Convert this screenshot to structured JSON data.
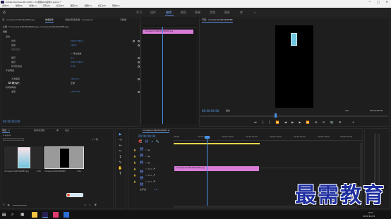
{
  "window": {
    "title": "Adobe Premiere Pro 2020 - D:\\视频\\01\\最新\\1.prproj *",
    "controls": [
      "—",
      "□",
      "✕"
    ]
  },
  "menu": [
    "文件(F)",
    "编辑(E)",
    "剪辑(C)",
    "序列(S)",
    "标记(M)",
    "图形(G)",
    "视图(V)",
    "窗口(W)",
    "帮助(H)"
  ],
  "workspaces": [
    "学习",
    "组件",
    "编辑",
    "颜色",
    "效果",
    "音频",
    "图形",
    "库",
    "»"
  ],
  "workspace_active_index": 2,
  "effect_controls": {
    "tabs": [
      "源：mmexport1603426985.jpg",
      "效果控件",
      "音频剪辑混合器：mmexport",
      "元数据"
    ],
    "source_line": "主要 * mmexport1603426985.jpg ▸ mmexport1603426985.jpg",
    "section_video": "视频",
    "motion": "运动",
    "properties": [
      {
        "name": "位置",
        "value": "540.0    960.0"
      },
      {
        "name": "缩放",
        "value": "100.0"
      },
      {
        "name": "缩放宽度",
        "value": ""
      },
      {
        "name": "等比缩放",
        "value": "✓ 等比缩放"
      },
      {
        "name": "旋转",
        "value": "0.0"
      },
      {
        "name": "锚点",
        "value": "540.0    960.0"
      },
      {
        "name": "防闪烁滤镜",
        "value": "0.00"
      }
    ],
    "opacity": {
      "name": "不透明度",
      "value": "100.0 %",
      "blend_label": "混合模式",
      "blend_value": "正常"
    },
    "time_remap": "时间重映射",
    "speed": {
      "name": "速度",
      "value": "100.00%"
    },
    "timecode": "00:00:00:00",
    "mini_clip_label": "mmexport1603426985.jpg"
  },
  "program": {
    "title": "节目：mmexport1603426985",
    "timecode": "00:00:00:00",
    "fit": "适合",
    "fraction": "1/2",
    "duration": "00:00:05:00",
    "buttons": [
      "⏮",
      "{",
      "}",
      "⏪",
      "◀",
      "▶",
      "▶",
      "⏩",
      "⊞",
      "⊟",
      "📷",
      "⚙",
      "+"
    ]
  },
  "project": {
    "tabs": [
      "项目：1",
      "媒体浏览器",
      "库",
      "信息"
    ],
    "path": "1.prproj",
    "count": "2 个项",
    "items": [
      {
        "name": "mmexport1603426985.jpg",
        "duration": "5:00"
      },
      {
        "name": "mmexport1603426985",
        "duration": "5:00"
      }
    ]
  },
  "timeline": {
    "title": "mmexport1603426985 ≡",
    "timecode": "00:00:00:00",
    "ruler": [
      "00:00",
      "00:00:05:00",
      "00:00:10:00",
      "00:00:15:00",
      "00:00:20:00",
      "00:00:25:00",
      "00:00:30:00",
      "00:00:35:00"
    ],
    "tracks": [
      "V3",
      "V2",
      "V1",
      "A1",
      "A2",
      "A3"
    ],
    "master": "主声道",
    "master_value": "0.0",
    "clip": "mmexport1603426985.jpg"
  },
  "tools": [
    "▶",
    "⇥",
    "↔",
    "◆",
    "✂",
    "↕",
    "✎",
    "✋",
    "T"
  ],
  "taskbar": {
    "time": "9:57",
    "date": "2021/10/22"
  },
  "watermark": "最需教育",
  "colors": {
    "accent": "#5b8de0",
    "clip": "#d87cd8",
    "playhead": "#4a90e2"
  }
}
